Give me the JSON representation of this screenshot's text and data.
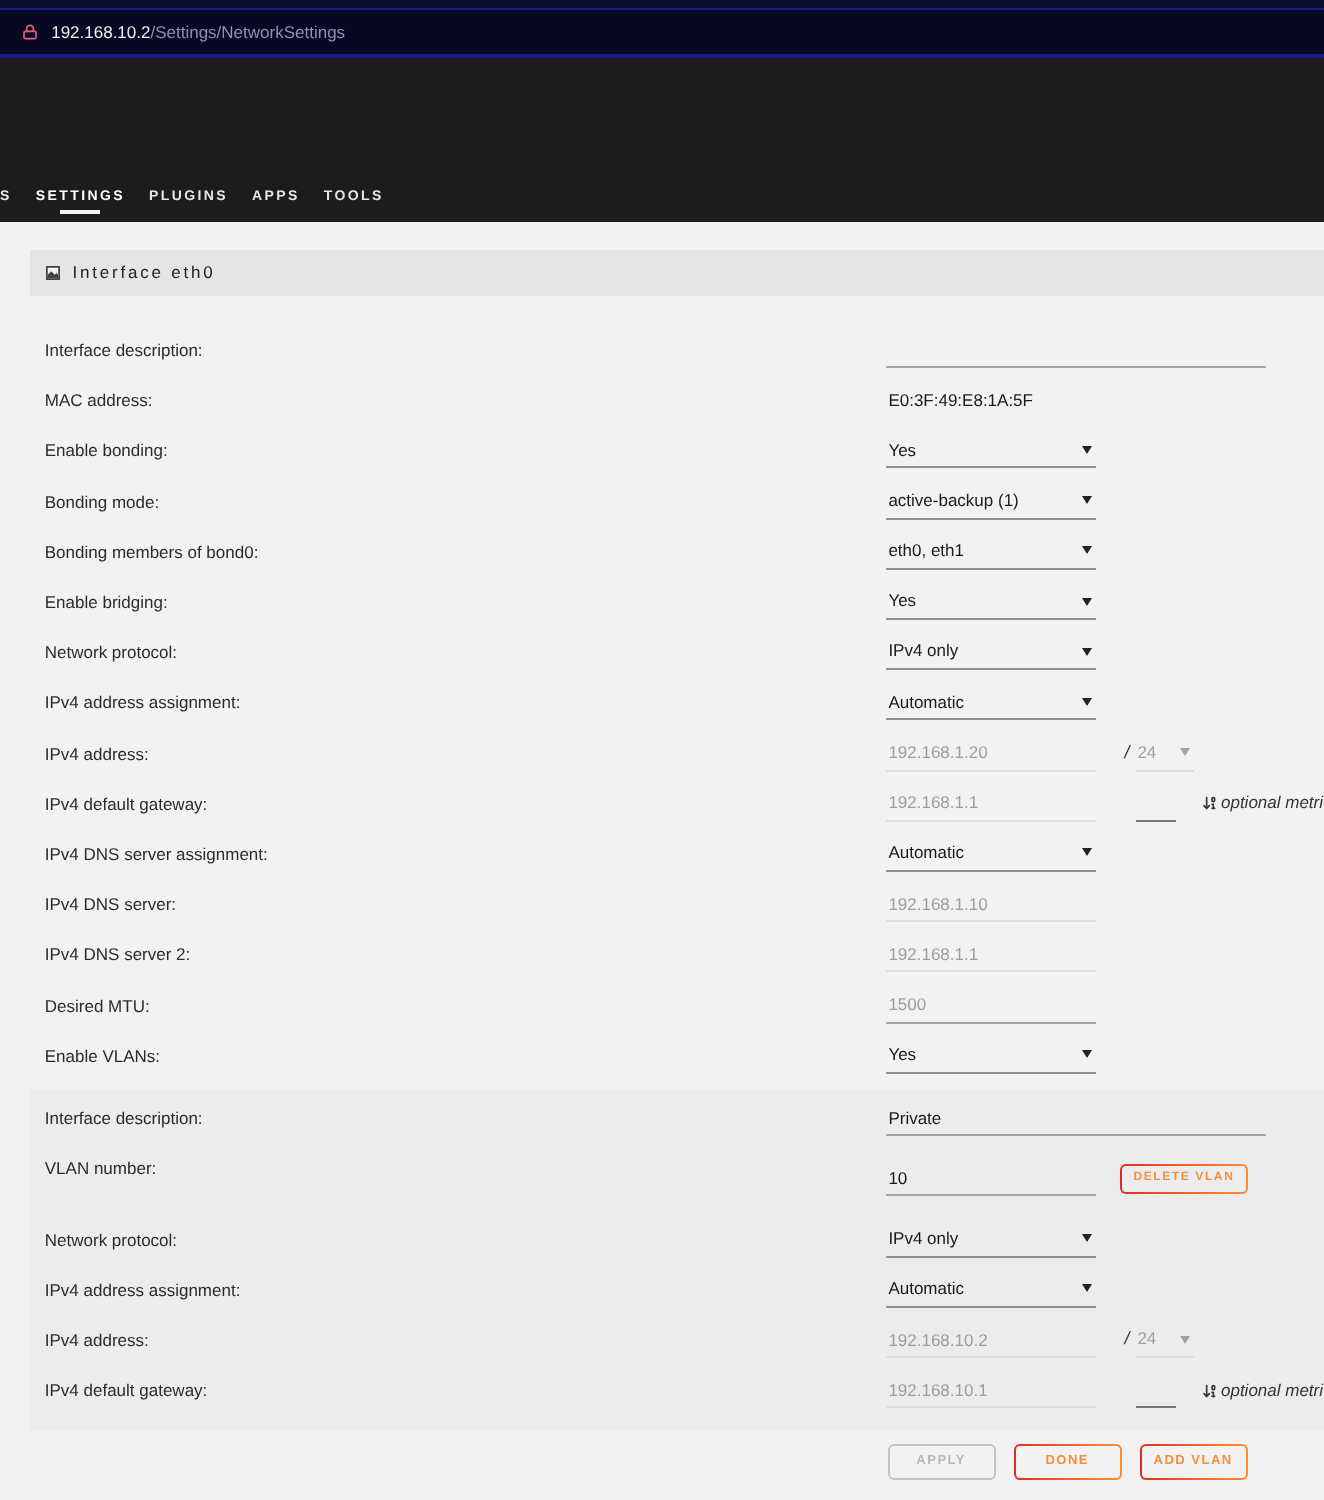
{
  "browser": {
    "url_host": "192.168.10.2",
    "url_path": "/Settings/NetworkSettings"
  },
  "nav": [
    {
      "label": "S",
      "selected": false
    },
    {
      "label": "SETTINGS",
      "selected": true
    },
    {
      "label": "PLUGINS",
      "selected": false
    },
    {
      "label": "APPS",
      "selected": false
    },
    {
      "label": "TOOLS",
      "selected": false
    }
  ],
  "interface": {
    "title": "Interface eth0",
    "rows": [
      {
        "kind": "description",
        "label": "Interface description:"
      },
      {
        "kind": "text",
        "label": "MAC address:",
        "value": "E0:3F:49:E8:1A:5F"
      },
      {
        "kind": "select",
        "label": "Enable bonding:",
        "value": "Yes"
      },
      {
        "kind": "select",
        "label": "Bonding mode:",
        "value": "active-backup (1)"
      },
      {
        "kind": "select",
        "label": "Bonding members of bond0:",
        "value": "eth0, eth1"
      },
      {
        "kind": "select",
        "label": "Enable bridging:",
        "value": "Yes"
      },
      {
        "kind": "select",
        "label": "Network protocol:",
        "value": "IPv4 only"
      },
      {
        "kind": "select",
        "label": "IPv4 address assignment:",
        "value": "Automatic"
      },
      {
        "kind": "address",
        "label": "IPv4 address:",
        "value": "192.168.1.20",
        "disabled": true,
        "separator": "/",
        "prefix": {
          "value": "24",
          "disabled": true
        }
      },
      {
        "kind": "gateway",
        "label": "IPv4 default gateway:",
        "value": "192.168.1.1",
        "disabled": true,
        "metric_hint": "optional metri"
      },
      {
        "kind": "select",
        "label": "IPv4 DNS server assignment:",
        "value": "Automatic"
      },
      {
        "kind": "input",
        "label": "IPv4 DNS server:",
        "value": "192.168.1.10",
        "disabled": true
      },
      {
        "kind": "input",
        "label": "IPv4 DNS server 2:",
        "value": "192.168.1.1",
        "disabled": true
      },
      {
        "kind": "input",
        "label": "Desired MTU:",
        "placeholder": "1500",
        "disabled": false
      },
      {
        "kind": "select",
        "label": "Enable VLANs:",
        "value": "Yes"
      }
    ]
  },
  "vlan": {
    "rows": [
      {
        "kind": "description",
        "label": "Interface description:",
        "value": "Private"
      },
      {
        "kind": "vlan_number",
        "label": "VLAN number:",
        "value": "10",
        "button": "DELETE VLAN"
      },
      {
        "kind": "select",
        "label": "Network protocol:",
        "value": "IPv4 only"
      },
      {
        "kind": "select",
        "label": "IPv4 address assignment:",
        "value": "Automatic"
      },
      {
        "kind": "address",
        "label": "IPv4 address:",
        "value": "192.168.10.2",
        "disabled": true,
        "separator": "/",
        "prefix": {
          "value": "24",
          "disabled": true
        }
      },
      {
        "kind": "gateway",
        "label": "IPv4 default gateway:",
        "value": "192.168.10.1",
        "disabled": true,
        "metric_hint": "optional metri"
      }
    ]
  },
  "buttons": [
    {
      "label": "APPLY",
      "disabled": true
    },
    {
      "label": "DONE",
      "disabled": false
    },
    {
      "label": "ADD VLAN",
      "disabled": false
    }
  ]
}
